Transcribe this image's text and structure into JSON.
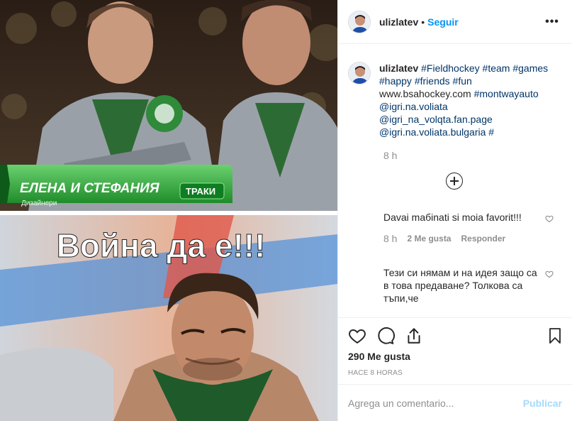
{
  "post": {
    "username": "ulizlatev",
    "follow_label": "Seguir",
    "more_label": "•••",
    "image": {
      "top_caption_name": "ЕЛЕНА И СТЕФАНИЯ",
      "top_caption_role": "Дизайнери",
      "top_caption_team": "ТРАКИ",
      "meme_text": "Война да е!!!"
    }
  },
  "caption": {
    "username": "ulizlatev",
    "parts": [
      {
        "text": "#Fieldhockey",
        "tag": true
      },
      {
        "text": "#team",
        "tag": true
      },
      {
        "text": "#games",
        "tag": true
      },
      {
        "text": "#happy",
        "tag": true
      },
      {
        "text": "#friends",
        "tag": true
      },
      {
        "text": "#fun",
        "tag": true
      },
      {
        "text": "www.bsahockey.com",
        "tag": false
      },
      {
        "text": "#montwayauto",
        "tag": true
      },
      {
        "text": "@igri.na.voliata",
        "tag": true
      },
      {
        "text": "@igri_na_volqta.fan.page",
        "tag": true
      },
      {
        "text": "@igri.na.voliata.bulgaria",
        "tag": true
      },
      {
        "text": "#",
        "tag": true
      }
    ],
    "time": "8 h"
  },
  "comments": [
    {
      "text": "Davai maбinati si moia favorit!!!",
      "time": "8 h",
      "likes": "2 Me gusta",
      "reply": "Responder"
    },
    {
      "text": "Тези си нямам и на идея защо са в това предаване? Толкова са тъпи,че"
    }
  ],
  "actions": {
    "likes": "290 Me gusta",
    "ago": "HACE 8 HORAS"
  },
  "add_comment": {
    "placeholder": "Agrega un comentario...",
    "publish_label": "Publicar"
  },
  "colors": {
    "link": "#003569",
    "accent": "#0095f6",
    "muted": "#8e8e8e",
    "caption_green": "#2eaa3a"
  },
  "icons": [
    "heart-icon",
    "comment-icon",
    "share-icon",
    "bookmark-icon",
    "plus-circle-icon",
    "more-icon"
  ]
}
